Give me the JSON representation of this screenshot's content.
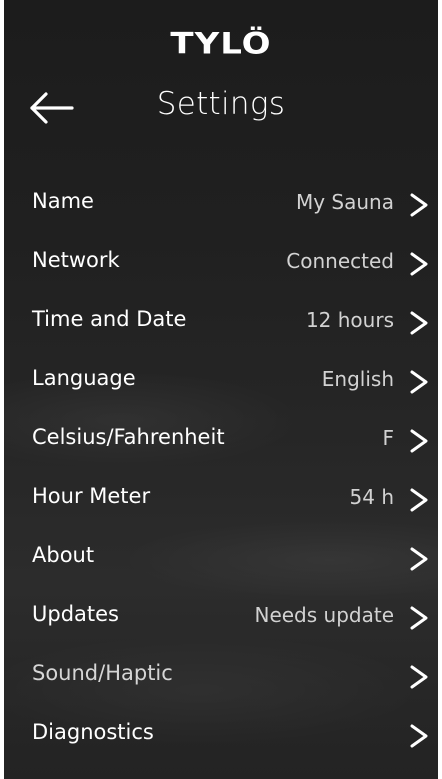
{
  "brand": {
    "logo_text": "TYLÖ"
  },
  "header": {
    "title": "Settings",
    "back_icon": "arrow-left-icon"
  },
  "settings": [
    {
      "id": "name",
      "label": "Name",
      "value": "My Sauna"
    },
    {
      "id": "network",
      "label": "Network",
      "value": "Connected"
    },
    {
      "id": "time-and-date",
      "label": "Time and Date",
      "value": "12 hours"
    },
    {
      "id": "language",
      "label": "Language",
      "value": "English"
    },
    {
      "id": "celsius-fahrenheit",
      "label": "Celsius/Fahrenheit",
      "value": "F"
    },
    {
      "id": "hour-meter",
      "label": "Hour Meter",
      "value": "54 h"
    },
    {
      "id": "about",
      "label": "About",
      "value": ""
    },
    {
      "id": "updates",
      "label": "Updates",
      "value": "Needs update"
    },
    {
      "id": "sound-haptic",
      "label": "Sound/Haptic",
      "value": ""
    },
    {
      "id": "diagnostics",
      "label": "Diagnostics",
      "value": ""
    }
  ],
  "row_icon": "chevron-right-icon",
  "colors": {
    "background": "#202020",
    "text": "#ffffff",
    "value_text": "#d2d2d2",
    "frame": "#ffffff"
  }
}
